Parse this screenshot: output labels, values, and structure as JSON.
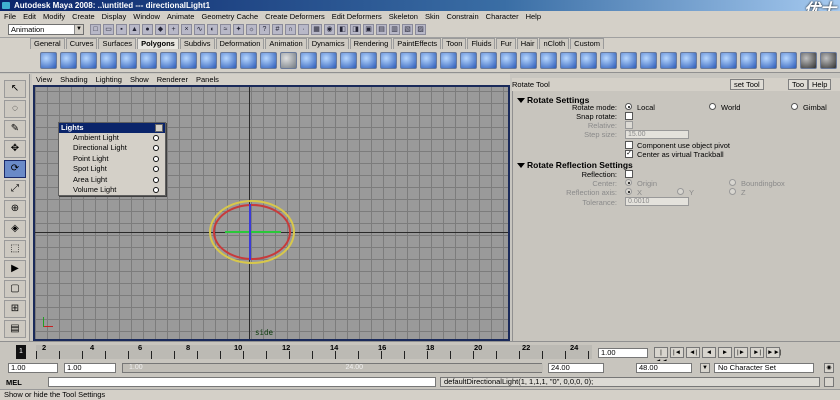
{
  "window": {
    "title": "Autodesk Maya 2008: ..\\untitled    ---    directionalLight1",
    "watermark": "优士"
  },
  "menubar": [
    "File",
    "Edit",
    "Modify",
    "Create",
    "Display",
    "Window",
    "Animate",
    "Geometry Cache",
    "Create Deformers",
    "Edit Deformers",
    "Skeleton",
    "Skin",
    "Constrain",
    "Character",
    "Help"
  ],
  "statusline": {
    "mode": "Animation"
  },
  "shelf_tabs": [
    "General",
    "Curves",
    "Surfaces",
    "Polygons",
    "Subdivs",
    "Deformation",
    "Animation",
    "Dynamics",
    "Rendering",
    "PaintEffects",
    "Toon",
    "Fluids",
    "Fur",
    "Hair",
    "nCloth",
    "Custom"
  ],
  "shelf_active_tab": "Polygons",
  "panel_menu": [
    "View",
    "Shading",
    "Lighting",
    "Show",
    "Renderer",
    "Panels"
  ],
  "viewport": {
    "camera_label": "side"
  },
  "lights_menu": {
    "title": "Lights",
    "items": [
      "Ambient Light",
      "Directional Light",
      "Point Light",
      "Spot Light",
      "Area Light",
      "Volume Light"
    ]
  },
  "tool_settings": {
    "title": "Rotate Tool",
    "reset_label": "set Tool",
    "tool_help_label": "Too",
    "help_label": "Help",
    "rotate_settings": {
      "header": "Rotate Settings",
      "rotate_mode_label": "Rotate mode:",
      "modes": [
        "Local",
        "World",
        "Gimbal"
      ],
      "selected_mode": "Local",
      "snap_rotate_label": "Snap rotate:",
      "relative_label": "Relative:",
      "step_size_label": "Step size:",
      "step_size_value": "15.00",
      "component_pivot_label": "Component use object pivot",
      "virtual_trackball_label": "Center as virtual Trackball"
    },
    "reflection_settings": {
      "header": "Rotate Reflection Settings",
      "reflection_label": "Reflection:",
      "center_label": "Center:",
      "center_options": [
        "Origin",
        "Boundingbox"
      ],
      "axis_label": "Reflection axis:",
      "axis_options": [
        "X",
        "Y",
        "Z"
      ],
      "tolerance_label": "Tolerance:",
      "tolerance_value": "0.0010"
    }
  },
  "timeslider": {
    "ticks": [
      "2",
      "4",
      "6",
      "8",
      "10",
      "12",
      "14",
      "16",
      "18",
      "20",
      "22",
      "24"
    ],
    "current_marker": "1",
    "current_frame": "1.00",
    "buttons": [
      "|◄◄",
      "|◄",
      "◄|",
      "◄",
      "►",
      "|►",
      "►|",
      "►►|"
    ]
  },
  "rangeslider": {
    "start": "1.00",
    "playback_start": "1.00",
    "bar_left": "1.00",
    "bar_right": "24.00",
    "playback_end": "24.00",
    "end": "48.00",
    "character_set": "No Character Set"
  },
  "cmdline": {
    "label": "MEL",
    "result": "defaultDirectionalLight(1, 1,1,1, \"0\", 0,0,0, 0);"
  },
  "helpline": {
    "text": "Show or hide the Tool Settings"
  }
}
